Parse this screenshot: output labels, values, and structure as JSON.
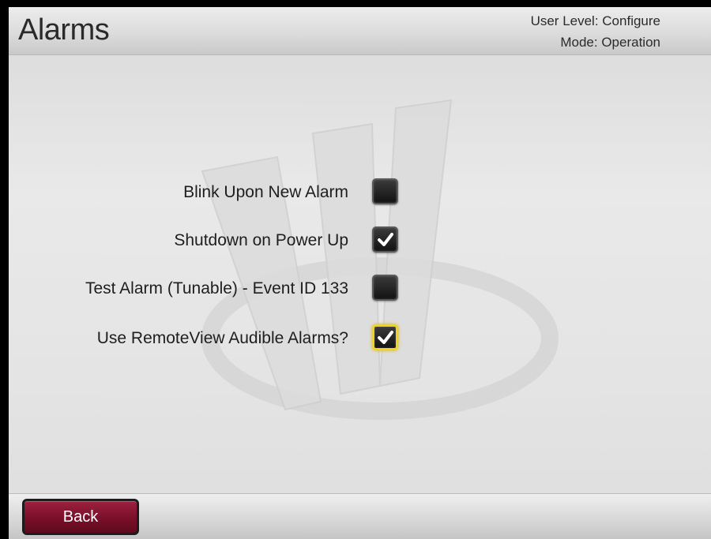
{
  "header": {
    "title": "Alarms",
    "user_level": "User Level: Configure",
    "mode": "Mode: Operation"
  },
  "settings": [
    {
      "label": "Blink Upon New Alarm",
      "checked": false,
      "focused": false
    },
    {
      "label": "Shutdown on Power Up",
      "checked": true,
      "focused": false
    },
    {
      "label": "Test Alarm (Tunable) - Event ID 133",
      "checked": false,
      "focused": false
    },
    {
      "label": "Use RemoteView Audible Alarms?",
      "checked": true,
      "focused": true
    }
  ],
  "footer": {
    "back_label": "Back"
  },
  "colors": {
    "accent_button": "#7a0f28",
    "focus_ring": "#f2d21b"
  },
  "icons": {
    "watermark": "logo-watermark-icon",
    "check": "checkmark-icon"
  }
}
